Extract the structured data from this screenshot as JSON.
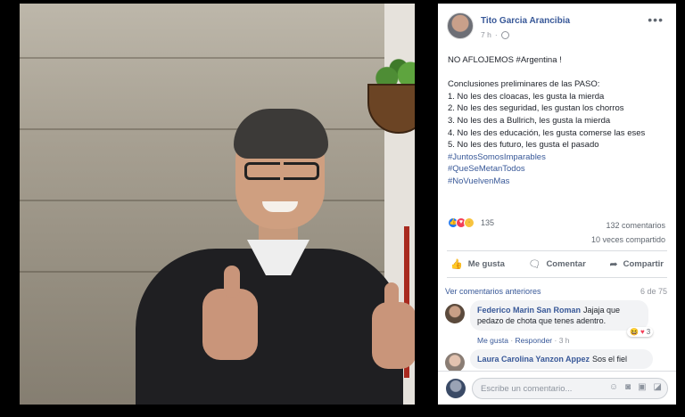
{
  "post": {
    "author": "Tito Garcia Arancibia",
    "time": "7 h",
    "more_icon": "more-dots-icon",
    "text_lines": [
      {
        "text": "NO AFLOJEMOS #Argentina !",
        "type": "plain"
      },
      {
        "text": "",
        "type": "gap"
      },
      {
        "text": "Conclusiones preliminares de las PASO:",
        "type": "plain"
      },
      {
        "text": "1. No les des cloacas, les gusta la mierda",
        "type": "plain"
      },
      {
        "text": "2. No les des seguridad, les gustan los chorros",
        "type": "plain"
      },
      {
        "text": "3. No les des a Bullrich, les gusta la mierda",
        "type": "plain"
      },
      {
        "text": "4. No les des educación, les gusta comerse las eses",
        "type": "plain"
      },
      {
        "text": "5. No les des futuro, les gusta el pasado",
        "type": "plain"
      },
      {
        "text": "#JuntosSomosImparables",
        "type": "hashtag"
      },
      {
        "text": "#QueSeMetanTodos",
        "type": "hashtag"
      },
      {
        "text": "#NoVuelvenMas",
        "type": "hashtag"
      }
    ]
  },
  "stats": {
    "reaction_count": "135",
    "comments": "132 comentarios",
    "shares": "10 veces compartido"
  },
  "actions": {
    "like": "Me gusta",
    "comment": "Comentar",
    "share": "Compartir"
  },
  "comments_section": {
    "previous_link": "Ver comentarios anteriores",
    "page_count": "6 de 75",
    "items": [
      {
        "name": "Federico Marin San Roman",
        "text_1": "Jajaja que",
        "text_2": "pedazo de chota que tenes adentro.",
        "like": "Me gusta",
        "reply": "Responder",
        "time": "3 h",
        "reaction_count": "3"
      },
      {
        "name": "Laura Carolina Yanzon Appez",
        "text_1": "Sos el fiel"
      }
    ]
  },
  "composer": {
    "placeholder": "Escribe un comentario..."
  },
  "colors": {
    "link_blue": "#385898",
    "like_blue": "#2078f4",
    "love_red": "#f33e58"
  }
}
